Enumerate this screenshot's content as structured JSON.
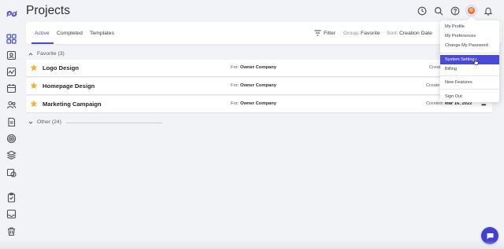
{
  "page": {
    "title": "Projects"
  },
  "colors": {
    "accent": "#4a4ad8",
    "star": "#f2b233",
    "chat": "#4141d4"
  },
  "sidebar": {
    "logo": "app-logo",
    "items": [
      {
        "icon": "grid-icon",
        "active": true
      },
      {
        "icon": "contact-card-icon"
      },
      {
        "icon": "activity-chart-icon"
      },
      {
        "icon": "calendar-icon"
      },
      {
        "icon": "users-icon"
      },
      {
        "icon": "document-icon"
      },
      {
        "icon": "target-icon"
      },
      {
        "icon": "layers-icon"
      },
      {
        "icon": "clock-calendar-icon"
      },
      {
        "icon": "clipboard-icon"
      },
      {
        "icon": "inbox-icon"
      },
      {
        "icon": "trash-icon"
      }
    ]
  },
  "topbar": {
    "icons": [
      "history-icon",
      "search-icon",
      "help-icon",
      "user-avatar",
      "bell-icon"
    ]
  },
  "tabs": {
    "items": [
      {
        "label": "Active",
        "active": true
      },
      {
        "label": "Completed"
      },
      {
        "label": "Templates"
      }
    ]
  },
  "toolbar": {
    "filter_label": "Filter",
    "group_prefix": "Group:",
    "group_value": "Favorite",
    "sort_prefix": "Sort:",
    "sort_value": "Creation Date"
  },
  "groups": {
    "favorite": {
      "label": "Favorite (3)"
    },
    "other": {
      "label": "Other (24)"
    }
  },
  "projects": [
    {
      "name": "Logo Design",
      "for_prefix": "For:",
      "for_value": "Owner Company",
      "created_prefix": "Creat",
      "created_value": "",
      "favorite": true
    },
    {
      "name": "Homepage Design",
      "for_prefix": "For:",
      "for_value": "Owner Company",
      "created_prefix": "Create",
      "created_value": "",
      "favorite": true
    },
    {
      "name": "Marketing Campaign",
      "for_prefix": "For:",
      "for_value": "Owner Company",
      "created_prefix": "Created:",
      "created_value": "Mar 16, 2022",
      "favorite": true
    }
  ],
  "user_menu": {
    "items": [
      {
        "label": "My Profile"
      },
      {
        "label": "My Preferences"
      },
      {
        "label": "Change My Password"
      },
      {
        "label": "System Settings",
        "highlighted": true
      },
      {
        "label": "Billing"
      },
      {
        "label": "New Features"
      },
      {
        "label": "Sign Out"
      }
    ]
  },
  "chat": {
    "icon": "chat-bubble-icon"
  }
}
